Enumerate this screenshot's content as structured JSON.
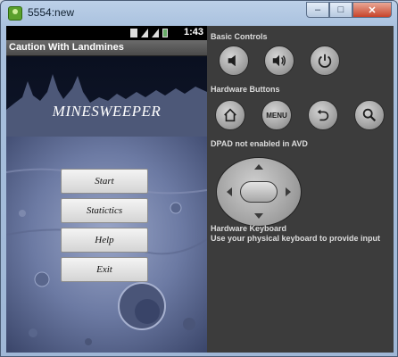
{
  "window": {
    "title": "5554:new",
    "minimize_glyph": "–",
    "maximize_glyph": "□",
    "close_glyph": "✕"
  },
  "statusbar": {
    "time": "1:43"
  },
  "app": {
    "title": "Caution With Landmines",
    "game_title": "MINESWEEPER",
    "menu": [
      "Start",
      "Statictics",
      "Help",
      "Exit"
    ]
  },
  "controls": {
    "basic_label": "Basic Controls",
    "basic_buttons": [
      "volume-down-icon",
      "volume-up-icon",
      "power-icon"
    ],
    "hardware_label": "Hardware Buttons",
    "hardware_buttons": [
      "home-icon",
      "menu",
      "back-icon",
      "search-icon"
    ],
    "menu_label": "MENU",
    "dpad_label": "DPAD not enabled in AVD",
    "keyboard_title": "Hardware Keyboard",
    "keyboard_text": "Use your physical keyboard to provide input"
  },
  "colors": {
    "emulator_bg": "#3c3c3c",
    "label_text": "#dcdcdc",
    "button_face": "#f4f4f4"
  }
}
